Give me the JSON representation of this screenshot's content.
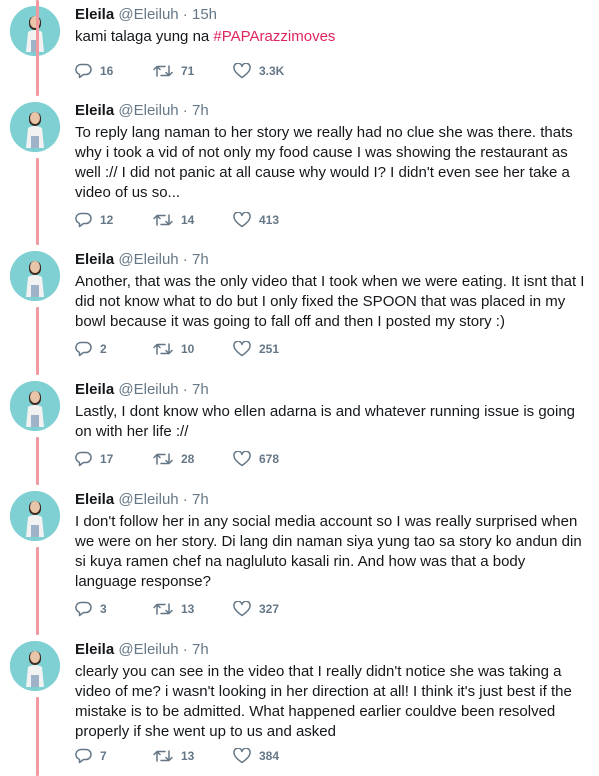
{
  "tweets": [
    {
      "name": "Eleila",
      "handle": "@Eleiluh",
      "time": "15h",
      "text_before": "kami talaga yung na ",
      "hashtag": "#PAPArazzimoves",
      "replies": "16",
      "retweets": "71",
      "likes": "3.3K"
    },
    {
      "name": "Eleila",
      "handle": "@Eleiluh",
      "time": "7h",
      "text": "To reply lang naman to her story  we really had no clue she was there. thats why i took a vid of not only my food cause I was showing the restaurant as well :// I did not panic at all cause why would I? I didn't even see her take a video of us so...",
      "replies": "12",
      "retweets": "14",
      "likes": "413"
    },
    {
      "name": "Eleila",
      "handle": "@Eleiluh",
      "time": "7h",
      "text": "Another, that was the only video that I took when we were eating. It isnt that I did not know what to do but I only fixed the SPOON that was placed in my bowl because it was going to fall off and then I posted my story :)",
      "replies": "2",
      "retweets": "10",
      "likes": "251"
    },
    {
      "name": "Eleila",
      "handle": "@Eleiluh",
      "time": "7h",
      "text": "Lastly, I dont know who ellen adarna is and whatever running issue is going on with her life ://",
      "replies": "17",
      "retweets": "28",
      "likes": "678"
    },
    {
      "name": "Eleila",
      "handle": "@Eleiluh",
      "time": "7h",
      "text": "I don't follow her in any social media account so I was really surprised when we were on her story. Di lang din naman siya yung tao sa story ko andun din si kuya ramen chef na nagluluto kasali rin. And how was that a body language response?",
      "replies": "3",
      "retweets": "13",
      "likes": "327"
    },
    {
      "name": "Eleila",
      "handle": "@Eleiluh",
      "time": "7h",
      "text": "clearly you can see in the video that I really didn't notice she was taking a video of me? i wasn't looking in her direction at all! I think it's just best if the mistake is to be admitted. What happened earlier couldve been resolved properly if she went up to us and asked",
      "replies": "7",
      "retweets": "13",
      "likes": "384"
    }
  ],
  "separator": " · ",
  "icons": {
    "reply": "reply-icon",
    "retweet": "retweet-icon",
    "like": "heart-icon",
    "avatar": "avatar"
  },
  "colors": {
    "thread_line": "#f29a9f",
    "hashtag": "#e0245e",
    "meta": "#657786",
    "avatar_bg": "#7fd0d3"
  }
}
